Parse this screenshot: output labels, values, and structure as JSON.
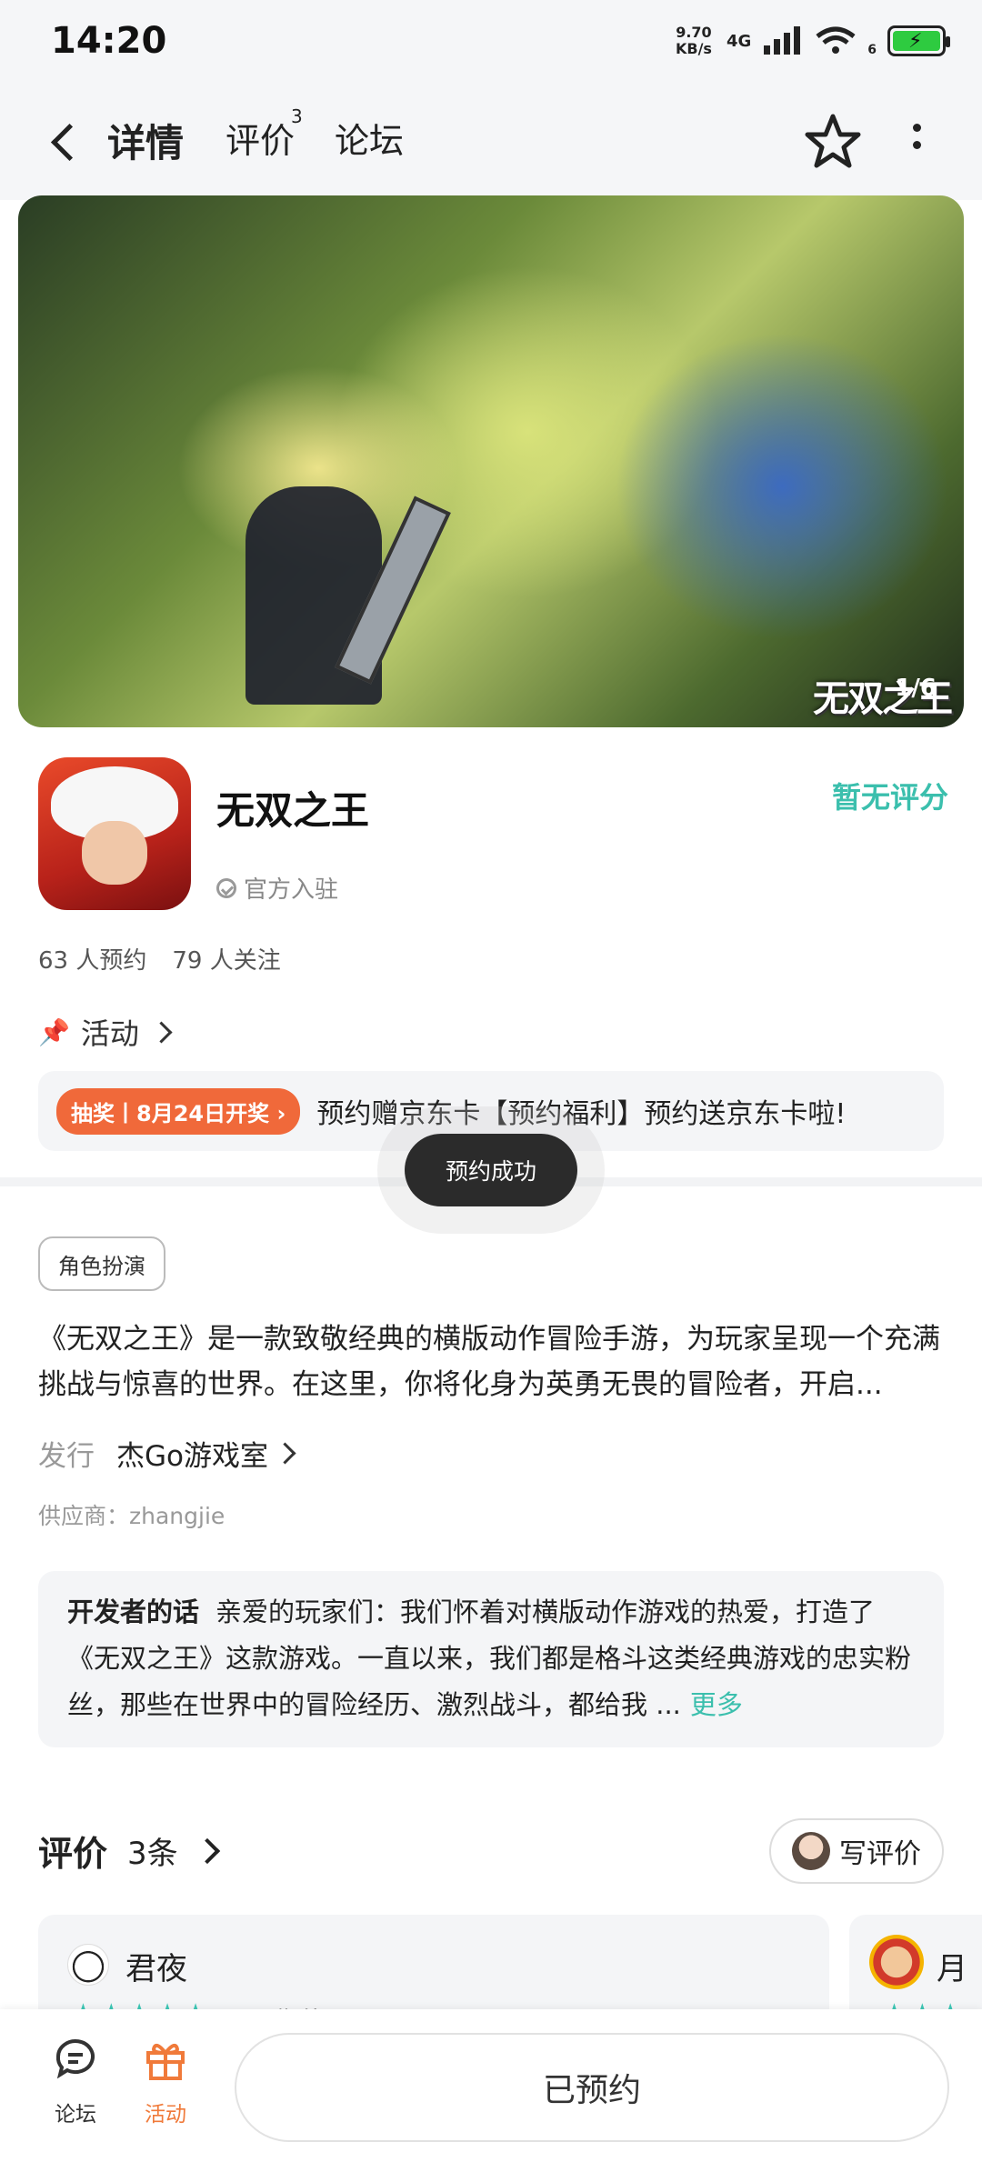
{
  "status_bar": {
    "time": "14:20",
    "net_speed_value": "9.70",
    "net_speed_unit": "KB/s",
    "network": "4G",
    "signal_sub": "6"
  },
  "nav": {
    "tabs": [
      {
        "label": "详情",
        "active": true
      },
      {
        "label": "评价",
        "badge": "3"
      },
      {
        "label": "论坛"
      }
    ],
    "icons": [
      "back-icon",
      "star-icon",
      "more-icon"
    ]
  },
  "banner": {
    "counter": "1/6",
    "logo_text": "无双之王"
  },
  "game": {
    "title": "无双之王",
    "official_label": "官方入驻",
    "rating_text": "暂无评分",
    "reservations": "63 人预约",
    "followers": "79 人关注"
  },
  "activity": {
    "header": "活动",
    "badge": "抽奖丨8月24日开奖",
    "text": "预约赠京东卡【预约福利】预约送京东卡啦!"
  },
  "toast": "预约成功",
  "details": {
    "tag": "角色扮演",
    "description": "《无双之王》是一款致敬经典的横版动作冒险手游，为玩家呈现一个充满挑战与惊喜的世界。在这里，你将化身为英勇无畏的冒险者，开启...",
    "publisher_label": "发行",
    "publisher_value": "杰Go游戏室",
    "supplier": "供应商：zhangjie"
  },
  "developer": {
    "label": "开发者的话",
    "text": "亲爱的玩家们：我们怀着对横版动作游戏的热爱，打造了《无双之王》这款游戏。一直以来，我们都是格斗这类经典游戏的忠实粉丝，那些在世界中的冒险经历、激烈战斗，都给我 ...",
    "more": "更多"
  },
  "reviews": {
    "title": "评价",
    "count": "3条",
    "write_label": "写评价",
    "items": [
      {
        "name": "君夜",
        "stars": "★★★★★",
        "tag": "期待"
      },
      {
        "name": "月",
        "stars": "★★★"
      }
    ]
  },
  "bottom": {
    "forum_label": "论坛",
    "activity_label": "活动",
    "reserve_label": "已预约"
  },
  "colors": {
    "accent": "#3bbfad",
    "orange": "#f07a3a"
  }
}
